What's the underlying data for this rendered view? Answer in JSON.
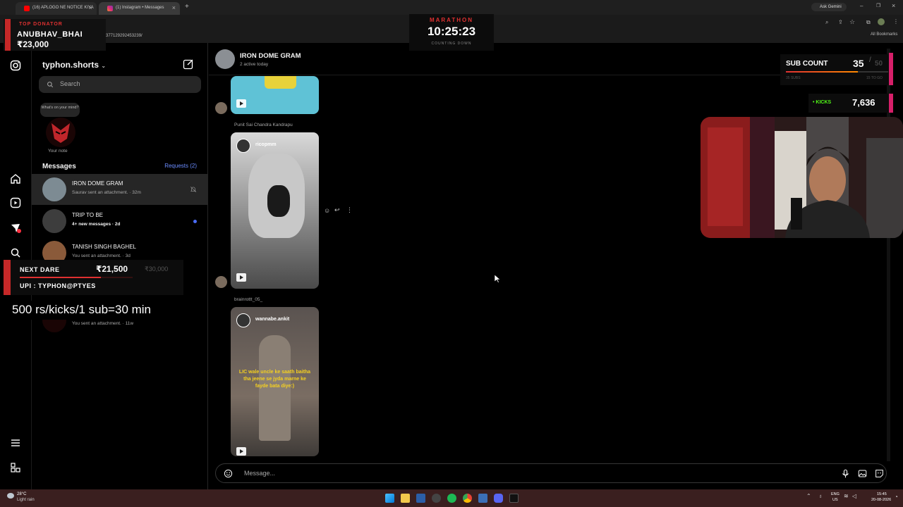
{
  "browser": {
    "tabs": [
      {
        "label": "(16) APLOGO NE NOTICE KIYA"
      },
      {
        "label": "(1) Instagram • Messages"
      }
    ],
    "url": "377129292453239/",
    "ask_gemini": "Ask Gemini",
    "bookmarks": "All Bookmarks"
  },
  "inbox": {
    "username": "typhon.shorts",
    "search_placeholder": "Search",
    "note_bubble": "What's on your mind?",
    "note_label": "Your note",
    "messages_header": "Messages",
    "requests": "Requests (2)",
    "conversations": [
      {
        "name": "IRON DOME GRAM",
        "sub": "Saurav sent an attachment. · 32m"
      },
      {
        "name": "TRIP TO BE",
        "sub": "4+ new messages · 2d"
      },
      {
        "name": "TANISH SINGH BAGHEL",
        "sub": "You sent an attachment. · 3d"
      },
      {
        "name": "",
        "sub": "You sent an attachment. · 11w"
      }
    ]
  },
  "chat": {
    "title": "IRON DOME GRAM",
    "status": "2 active today",
    "senders": [
      "Punit Sai Chandra Kandrapu",
      "brainrottt_05_"
    ],
    "reels": [
      {
        "handle": "ricopmm",
        "caption": ""
      },
      {
        "handle": "wannabe.ankit",
        "caption": "LIC wale uncle ke saath baitha tha jeene se jyda marne ke fayde bata diye:)"
      }
    ],
    "message_placeholder": "Message..."
  },
  "overlays": {
    "top_donator_label": "TOP DONATOR",
    "top_donator_name": "ANUBHAV_BHAI",
    "top_donator_amount": "₹23,000",
    "marathon_label": "MARATHON",
    "marathon_time": "10:25:23",
    "marathon_sub": "COUNTING DOWN",
    "sub_count_label": "SUB COUNT",
    "sub_count_value": "35",
    "sub_count_goal": "50",
    "sub_small_left": "35 SUBS",
    "sub_small_right": "15 TO GO",
    "kicks_label": "• KICKS",
    "kicks_value": "7,636",
    "next_dare_label": "NEXT DARE",
    "next_dare_amount": "₹21,500",
    "next_dare_goal": "₹30,000",
    "upi": "UPI : TYPHON@PTYES",
    "rate_note": "500 rs/kicks/1 sub=30 min",
    "sub_progress": 0.7,
    "dare_progress": 0.72
  },
  "taskbar": {
    "weather_temp": "28°C",
    "weather_desc": "Light rain",
    "lang_top": "ENG",
    "lang_bottom": "US",
    "time": "15:45",
    "date": "20-08-2026"
  }
}
